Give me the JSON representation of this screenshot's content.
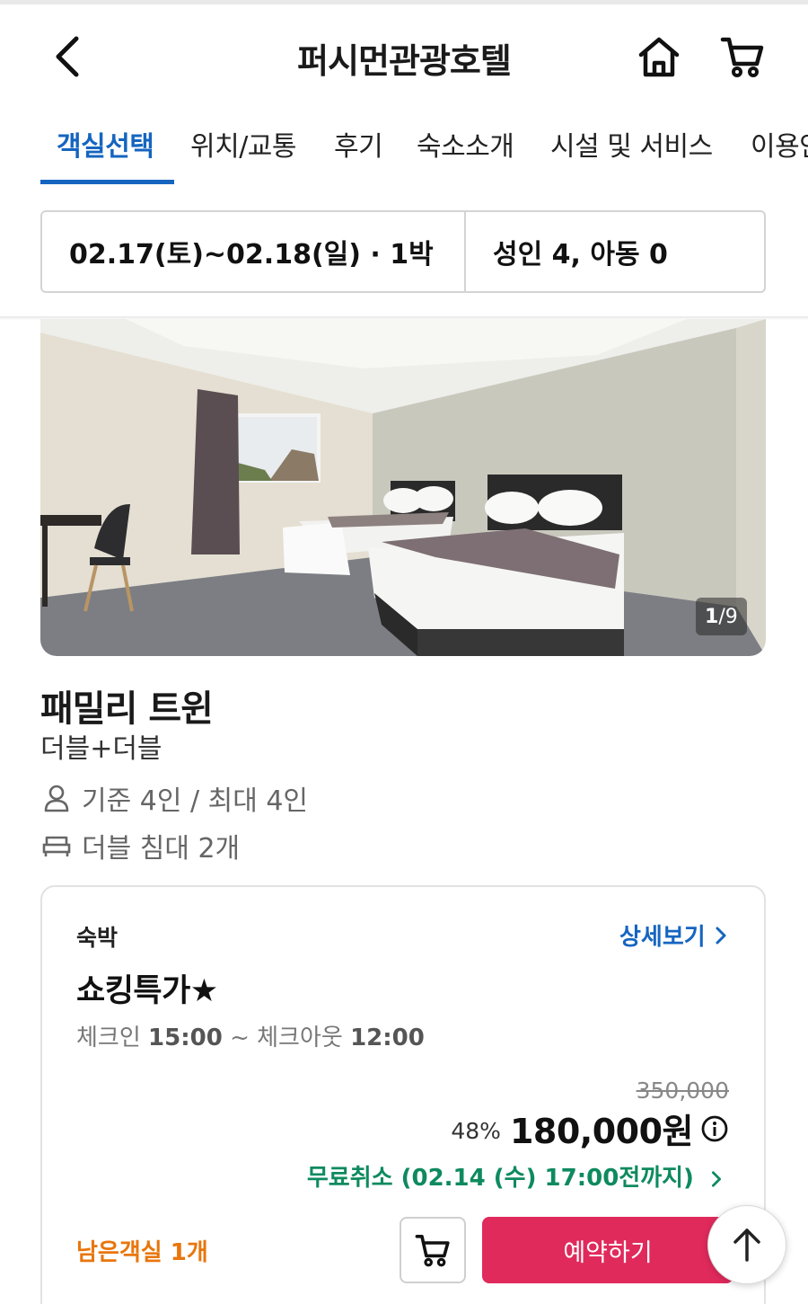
{
  "header": {
    "title": "퍼시먼관광호텔",
    "back_icon": "chevron-left-icon",
    "home_icon": "home-icon",
    "cart_icon": "cart-icon"
  },
  "tabs": [
    {
      "label": "객실선택",
      "active": true
    },
    {
      "label": "위치/교통",
      "active": false
    },
    {
      "label": "후기",
      "active": false
    },
    {
      "label": "숙소소개",
      "active": false
    },
    {
      "label": "시설 및 서비스",
      "active": false
    },
    {
      "label": "이용안내",
      "active": false
    }
  ],
  "search": {
    "dates": "02.17(토)~02.18(일) · 1박",
    "guests": "성인 4, 아동 0"
  },
  "photo": {
    "current": "1",
    "total": "/9"
  },
  "room": {
    "name": "패밀리 트윈",
    "bed_type": "더블+더블",
    "capacity": "기준 4인 / 최대 4인",
    "beds": "더블 침대 2개"
  },
  "rate": {
    "type": "숙박",
    "detail_link": "상세보기",
    "plan_name": "쇼킹특가★",
    "checkin_label": "체크인",
    "checkin_time": "15:00",
    "sep": "~",
    "checkout_label": "체크아웃",
    "checkout_time": "12:00",
    "original_price": "350,000",
    "discount": "48%",
    "price": "180,000원",
    "free_cancel": "무료취소 (02.14 (수) 17:00전까지)",
    "rooms_left": "남은객실 1개",
    "book_label": "예약하기"
  },
  "colors": {
    "accent": "#1565c0",
    "book_button": "#e02a5c",
    "free_cancel": "#0e8a5f",
    "rooms_left": "#e8760c"
  }
}
